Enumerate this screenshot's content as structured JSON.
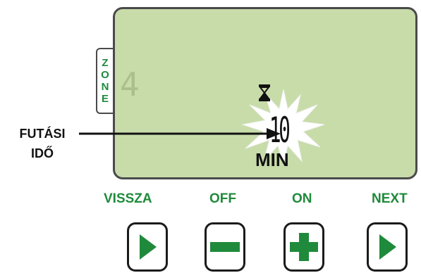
{
  "display": {
    "zone_letters": [
      "Z",
      "O",
      "N",
      "E"
    ],
    "zone_number": "4",
    "run_time_value": "10",
    "run_time_unit": "MIN"
  },
  "callout": {
    "line1": "FUTÁSI",
    "line2": "IDŐ"
  },
  "buttons": {
    "back_label": "VISSZA",
    "off_label": "OFF",
    "on_label": "ON",
    "next_label": "NEXT"
  },
  "colors": {
    "lcd_background": "#c8dcaa",
    "button_green": "#1f8a3b",
    "text": "#111111"
  },
  "icons": [
    "hourglass-icon",
    "play-icon",
    "minus-icon",
    "plus-icon"
  ]
}
